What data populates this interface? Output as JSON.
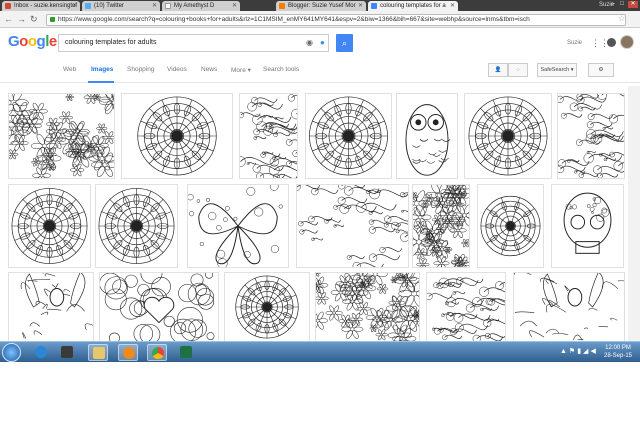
{
  "browser": {
    "tabs": [
      {
        "label": "Inbox - suzie.kensingtof",
        "color": "#d44638"
      },
      {
        "label": "(10) Twitter",
        "color": "#55acee"
      },
      {
        "label": "My Amethyst D",
        "color": "#e8e8e8"
      },
      {
        "label": "Blogger: Suzie Yusef Mor",
        "color": "#f57d00"
      },
      {
        "label": "colouring templates for a",
        "color": "#4285f4"
      }
    ],
    "profile_name": "Suzie",
    "url": "https://www.google.com/search?q=colouring+books+for+adults&rlz=1C1MSIM_enMY641MY641&espv=2&biw=1366&bih=667&site=webhp&source=lnms&tbm=isch"
  },
  "google": {
    "logo": "Google",
    "query": "colouring templates for adults",
    "user_label": "Suzie",
    "nav": {
      "web": "Web",
      "images": "Images",
      "shopping": "Shopping",
      "videos": "Videos",
      "news": "News",
      "more": "More",
      "search_tools": "Search tools"
    },
    "safesearch": "SafeSearch"
  },
  "taskbar": {
    "time": "12:00 PM",
    "date": "28-Sep-15"
  },
  "icons": [
    "search-icon",
    "camera-icon",
    "mic-icon",
    "apps-icon",
    "bell-icon",
    "gear-icon",
    "person-icon",
    "globe-icon",
    "lock-icon",
    "star-icon"
  ]
}
